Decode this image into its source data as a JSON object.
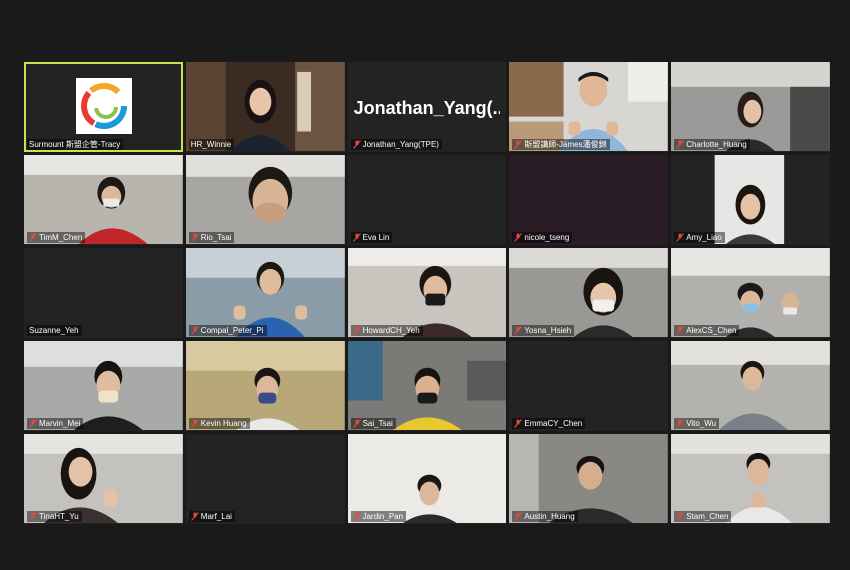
{
  "colors": {
    "active_border": "#c9e34a",
    "mute_icon": "#e5483f",
    "background": "#1a1a1a",
    "tile_bg": "#232323"
  },
  "participants": [
    {
      "name": "Surmount 斯盟企管-Tracy",
      "muted": false,
      "active": true,
      "type": "logo"
    },
    {
      "name": "HR_Winnie",
      "muted": false,
      "type": "video"
    },
    {
      "name": "Jonathan_Yang(TPE)",
      "display_name": "Jonathan_Yang(...",
      "muted": true,
      "type": "text"
    },
    {
      "name": "斯盟講師-James潘俊錦",
      "muted": true,
      "type": "video"
    },
    {
      "name": "Charlotte_Huang",
      "muted": true,
      "type": "video"
    },
    {
      "name": "TimM_Chen",
      "muted": true,
      "type": "video"
    },
    {
      "name": "Rio_Tsai",
      "muted": true,
      "type": "video"
    },
    {
      "name": "Eva Lin",
      "muted": true,
      "type": "empty"
    },
    {
      "name": "nicole_tseng",
      "muted": true,
      "type": "empty"
    },
    {
      "name": "Amy_Liao",
      "muted": true,
      "type": "video"
    },
    {
      "name": "Suzanne_Yeh",
      "muted": false,
      "type": "empty"
    },
    {
      "name": "Compal_Peter_Pi",
      "muted": true,
      "type": "video"
    },
    {
      "name": "HowardCH_Yeh",
      "muted": true,
      "type": "video"
    },
    {
      "name": "Yosna_Hsieh",
      "muted": true,
      "type": "video"
    },
    {
      "name": "AlexCS_Chen",
      "muted": true,
      "type": "video"
    },
    {
      "name": "Marvin_Mei",
      "muted": true,
      "type": "video"
    },
    {
      "name": "Kevin Huang",
      "muted": true,
      "type": "video"
    },
    {
      "name": "Sai_Tsai",
      "muted": true,
      "type": "video"
    },
    {
      "name": "EmmaCY_Chen",
      "muted": true,
      "type": "empty"
    },
    {
      "name": "Vito_Wu",
      "muted": true,
      "type": "video"
    },
    {
      "name": "TinaHT_Yu",
      "muted": true,
      "type": "video"
    },
    {
      "name": "Marf_Lai",
      "muted": true,
      "type": "empty"
    },
    {
      "name": "Jardin_Pan",
      "muted": true,
      "type": "video"
    },
    {
      "name": "Austin_Huang",
      "muted": true,
      "type": "video"
    },
    {
      "name": "Stam_Chen",
      "muted": true,
      "type": "video"
    }
  ]
}
